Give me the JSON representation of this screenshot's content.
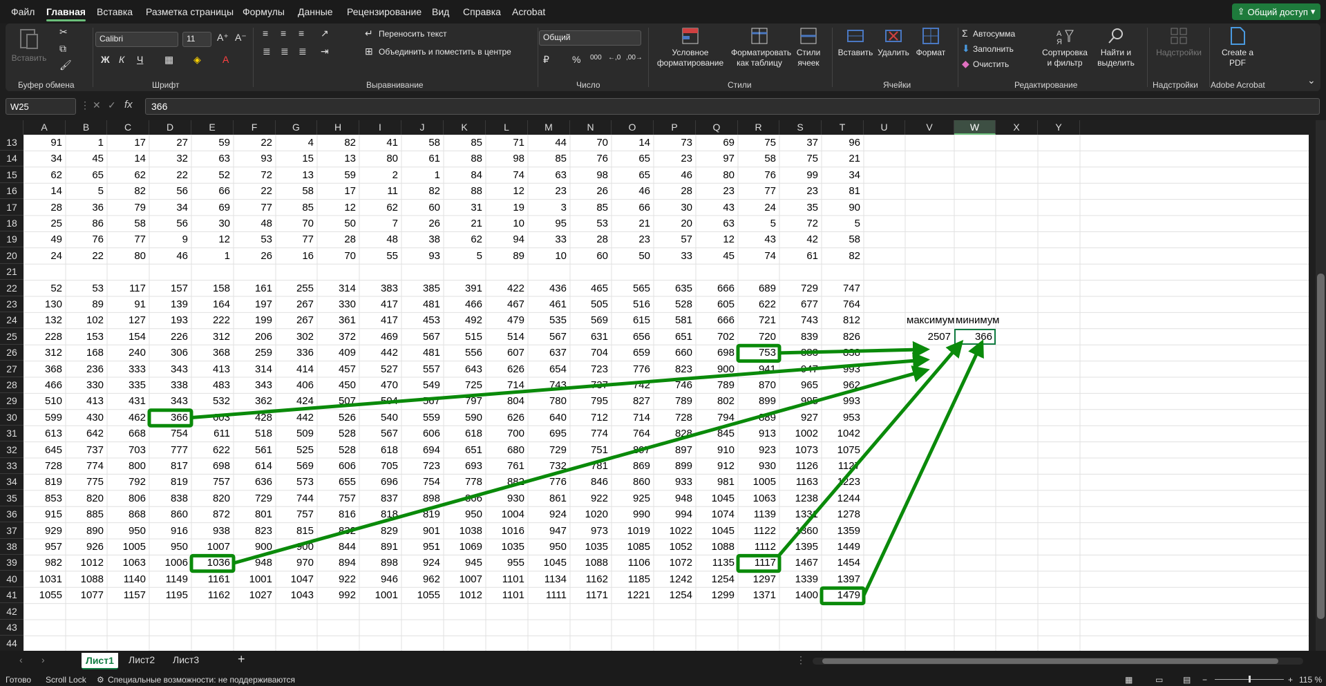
{
  "menu": {
    "items": [
      "Файл",
      "Главная",
      "Вставка",
      "Разметка страницы",
      "Формулы",
      "Данные",
      "Рецензирование",
      "Вид",
      "Справка",
      "Acrobat"
    ],
    "active": "Главная",
    "share": "Общий доступ"
  },
  "ribbon": {
    "clipboard": {
      "label": "Буфер обмена",
      "paste": "Вставить"
    },
    "font": {
      "label": "Шрифт",
      "name": "Calibri",
      "size": "11"
    },
    "alignment": {
      "label": "Выравнивание",
      "wrap": "Переносить текст",
      "merge": "Объединить и поместить в центре"
    },
    "number": {
      "label": "Число",
      "format": "Общий"
    },
    "styles": {
      "label": "Стили",
      "conditional": "Условное форматирование",
      "table": "Форматировать как таблицу",
      "cell_styles": "Стили ячеек"
    },
    "cells": {
      "label": "Ячейки",
      "insert": "Вставить",
      "delete": "Удалить",
      "format": "Формат"
    },
    "editing": {
      "label": "Редактирование",
      "autosum": "Автосумма",
      "fill": "Заполнить",
      "clear": "Очистить",
      "sort": "Сортировка и фильтр",
      "find": "Найти и выделить"
    },
    "addins": {
      "label": "Надстройки",
      "button": "Надстройки"
    },
    "acrobat": {
      "label": "Adobe Acrobat",
      "button": "Create a PDF"
    }
  },
  "formula_bar": {
    "name_box": "W25",
    "value": "366"
  },
  "columns": [
    "A",
    "B",
    "C",
    "D",
    "E",
    "F",
    "G",
    "H",
    "I",
    "J",
    "K",
    "L",
    "M",
    "N",
    "O",
    "P",
    "Q",
    "R",
    "S",
    "T",
    "U",
    "V",
    "W",
    "X",
    "Y"
  ],
  "selected_column": "W",
  "row_numbers": [
    13,
    14,
    15,
    16,
    17,
    18,
    19,
    20,
    21,
    22,
    23,
    24,
    25,
    26,
    27,
    28,
    29,
    30,
    31,
    32,
    33,
    34,
    35,
    36,
    37,
    38,
    39,
    40,
    41,
    42,
    43,
    44
  ],
  "rows": [
    [
      91,
      1,
      17,
      27,
      59,
      22,
      4,
      82,
      41,
      58,
      85,
      71,
      44,
      70,
      14,
      73,
      69,
      75,
      37,
      96
    ],
    [
      34,
      45,
      14,
      32,
      63,
      93,
      15,
      13,
      80,
      61,
      88,
      98,
      85,
      76,
      65,
      23,
      97,
      58,
      75,
      21
    ],
    [
      62,
      65,
      62,
      22,
      52,
      72,
      13,
      59,
      2,
      1,
      84,
      74,
      63,
      98,
      65,
      46,
      80,
      76,
      99,
      34
    ],
    [
      14,
      5,
      82,
      56,
      66,
      22,
      58,
      17,
      11,
      82,
      88,
      12,
      23,
      26,
      46,
      28,
      23,
      77,
      23,
      81
    ],
    [
      28,
      36,
      79,
      34,
      69,
      77,
      85,
      12,
      62,
      60,
      31,
      19,
      3,
      85,
      66,
      30,
      43,
      24,
      35,
      90
    ],
    [
      25,
      86,
      58,
      56,
      30,
      48,
      70,
      50,
      7,
      26,
      21,
      10,
      95,
      53,
      21,
      20,
      63,
      5,
      72,
      5
    ],
    [
      49,
      76,
      77,
      9,
      12,
      53,
      77,
      28,
      48,
      38,
      62,
      94,
      33,
      28,
      23,
      57,
      12,
      43,
      42,
      58
    ],
    [
      24,
      22,
      80,
      46,
      1,
      26,
      16,
      70,
      55,
      93,
      5,
      89,
      10,
      60,
      50,
      33,
      45,
      74,
      61,
      82
    ],
    [],
    [
      52,
      53,
      117,
      157,
      158,
      161,
      255,
      314,
      383,
      385,
      391,
      422,
      436,
      465,
      565,
      635,
      666,
      689,
      729,
      747
    ],
    [
      130,
      89,
      91,
      139,
      164,
      197,
      267,
      330,
      417,
      481,
      466,
      467,
      461,
      505,
      516,
      528,
      605,
      622,
      677,
      764
    ],
    [
      132,
      102,
      127,
      193,
      222,
      199,
      267,
      361,
      417,
      453,
      492,
      479,
      535,
      569,
      615,
      581,
      666,
      721,
      743,
      812
    ],
    [
      228,
      153,
      154,
      226,
      312,
      206,
      302,
      372,
      469,
      567,
      515,
      514,
      567,
      631,
      656,
      651,
      702,
      720,
      839,
      826
    ],
    [
      312,
      168,
      240,
      306,
      368,
      259,
      336,
      409,
      442,
      481,
      556,
      607,
      637,
      704,
      659,
      660,
      698,
      753,
      883,
      838
    ],
    [
      368,
      236,
      333,
      343,
      413,
      314,
      414,
      457,
      527,
      557,
      643,
      626,
      654,
      723,
      776,
      823,
      900,
      941,
      947,
      993
    ],
    [
      466,
      330,
      335,
      338,
      483,
      343,
      406,
      450,
      470,
      549,
      725,
      714,
      743,
      737,
      742,
      746,
      789,
      870,
      965,
      962
    ],
    [
      510,
      413,
      431,
      343,
      532,
      362,
      424,
      507,
      504,
      567,
      797,
      804,
      780,
      795,
      827,
      789,
      802,
      899,
      995,
      993
    ],
    [
      599,
      430,
      462,
      366,
      603,
      428,
      442,
      526,
      540,
      559,
      590,
      626,
      640,
      712,
      714,
      728,
      794,
      889,
      927,
      953
    ],
    [
      613,
      642,
      668,
      754,
      611,
      518,
      509,
      528,
      567,
      606,
      618,
      700,
      695,
      774,
      764,
      828,
      845,
      913,
      1002,
      1042
    ],
    [
      645,
      737,
      703,
      777,
      622,
      561,
      525,
      528,
      618,
      694,
      651,
      680,
      729,
      751,
      897,
      897,
      910,
      923,
      1073,
      1075
    ],
    [
      728,
      774,
      800,
      817,
      698,
      614,
      569,
      606,
      705,
      723,
      693,
      761,
      732,
      781,
      869,
      899,
      912,
      930,
      1126,
      1127
    ],
    [
      819,
      775,
      792,
      819,
      757,
      636,
      573,
      655,
      696,
      754,
      778,
      882,
      776,
      846,
      860,
      933,
      981,
      1005,
      1163,
      1223
    ],
    [
      853,
      820,
      806,
      838,
      820,
      729,
      744,
      757,
      837,
      898,
      866,
      930,
      861,
      922,
      925,
      948,
      1045,
      1063,
      1238,
      1244
    ],
    [
      915,
      885,
      868,
      860,
      872,
      801,
      757,
      816,
      818,
      819,
      950,
      1004,
      924,
      1020,
      990,
      994,
      1074,
      1139,
      1331,
      1278
    ],
    [
      929,
      890,
      950,
      916,
      938,
      823,
      815,
      832,
      829,
      901,
      1038,
      1016,
      947,
      973,
      1019,
      1022,
      1045,
      1122,
      1360,
      1359
    ],
    [
      957,
      926,
      1005,
      950,
      1007,
      900,
      900,
      844,
      891,
      951,
      1069,
      1035,
      950,
      1035,
      1085,
      1052,
      1088,
      1112,
      1395,
      1449
    ],
    [
      982,
      1012,
      1063,
      1006,
      1036,
      948,
      970,
      894,
      898,
      924,
      945,
      955,
      1045,
      1088,
      1106,
      1072,
      1135,
      1117,
      1467,
      1454
    ],
    [
      1031,
      1088,
      1140,
      1149,
      1161,
      1001,
      1047,
      922,
      946,
      962,
      1007,
      1101,
      1134,
      1162,
      1185,
      1242,
      1254,
      1297,
      1339,
      1397
    ],
    [
      1055,
      1077,
      1157,
      1195,
      1162,
      1027,
      1043,
      992,
      1001,
      1055,
      1012,
      1101,
      1111,
      1171,
      1221,
      1254,
      1299,
      1371,
      1400,
      1479
    ],
    [],
    [],
    []
  ],
  "side_labels": {
    "max_label": "максимум",
    "min_label": "минимум",
    "max_value": "2507",
    "min_value": "366"
  },
  "sheets": [
    "Лист1",
    "Лист2",
    "Лист3"
  ],
  "active_sheet": "Лист1",
  "status": {
    "ready": "Готово",
    "scroll_lock": "Scroll Lock",
    "accessibility": "Специальные возможности: не поддерживаются",
    "zoom": "115 %"
  },
  "colors": {
    "accent": "#107c41",
    "highlight": "#0a8a0a"
  }
}
